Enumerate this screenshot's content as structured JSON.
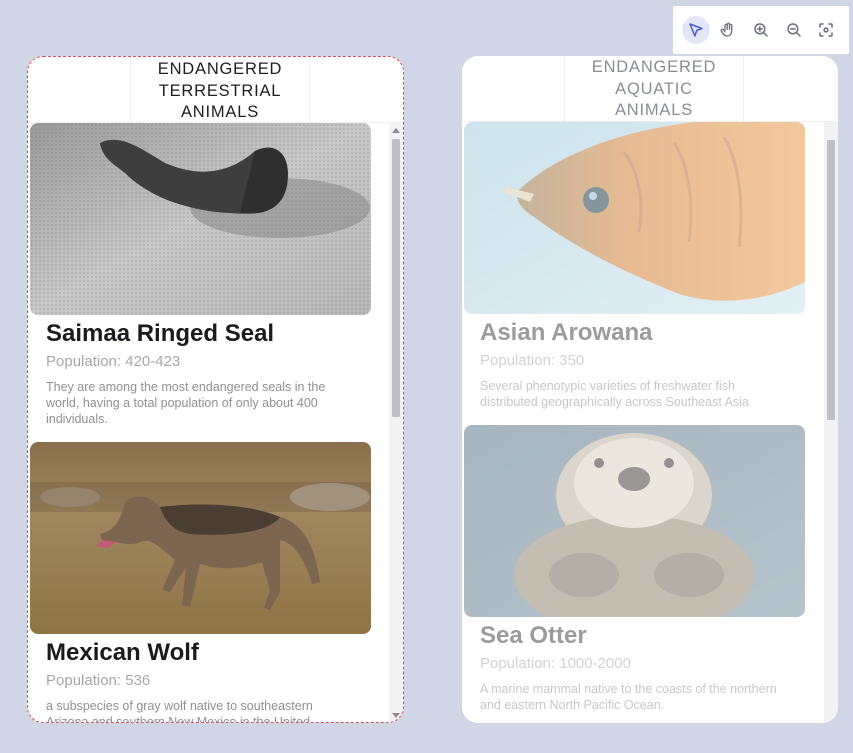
{
  "toolbar": {
    "tools": [
      {
        "icon": "pointer-icon",
        "active": true
      },
      {
        "icon": "hand-icon",
        "active": false
      },
      {
        "icon": "zoom-in-icon",
        "active": false
      },
      {
        "icon": "zoom-out-icon",
        "active": false
      },
      {
        "icon": "fit-screen-icon",
        "active": false
      }
    ]
  },
  "terrestrial": {
    "title_lines": [
      "ENDANGERED",
      "TERRESTRIAL",
      "ANIMALS"
    ],
    "cards": [
      {
        "name": "Saimaa Ringed Seal",
        "population": "Population: 420-423",
        "description": "They are among the most endangered seals in the world, having a total population of only about 400 individuals."
      },
      {
        "name": "Mexican Wolf",
        "population": "Population: 536",
        "description": "a subspecies of gray wolf native to southeastern Arizona and southern New Mexico in the United"
      }
    ]
  },
  "aquatic": {
    "title_lines": [
      "ENDANGERED",
      "AQUATIC ANIMALS"
    ],
    "cards": [
      {
        "name": "Asian Arowana",
        "population": "Population: 350",
        "description": "Several phenotypic varieties of freshwater fish distributed geographically across Southeast Asia"
      },
      {
        "name": "Sea Otter",
        "population": "Population: 1000-2000",
        "description": "A marine mammal native to the coasts of the northern and eastern North Pacific Ocean."
      }
    ]
  },
  "colors": {
    "background": "#d1d6e6",
    "accent": "#4a5bd6",
    "selection_border": "#d44c5c"
  }
}
